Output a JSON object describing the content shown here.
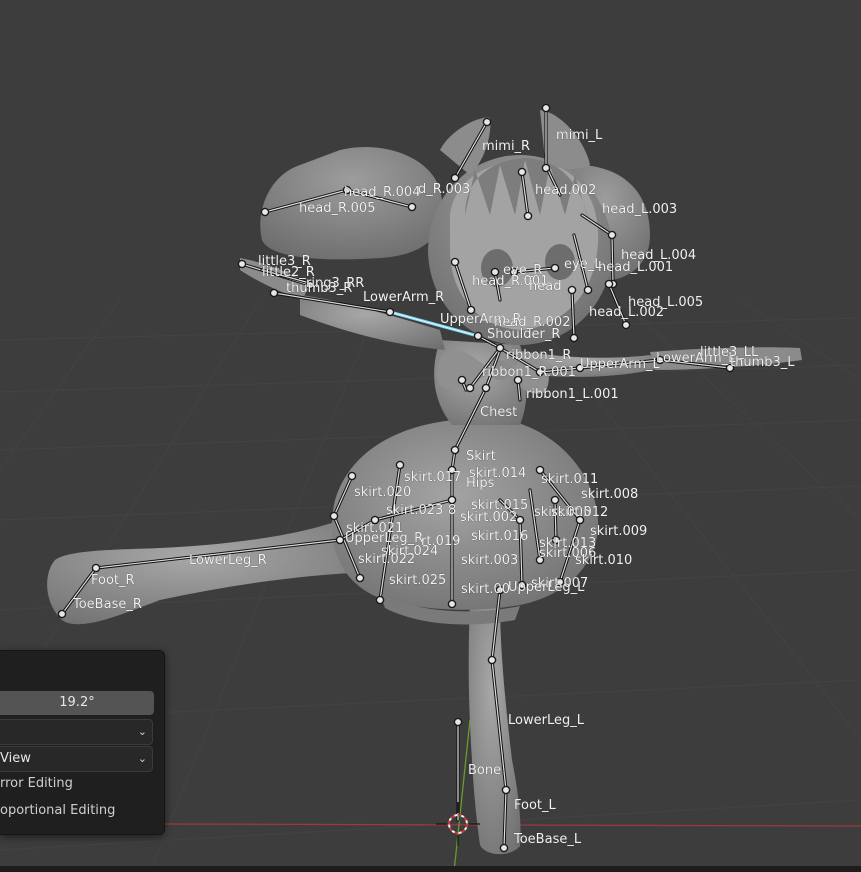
{
  "panel": {
    "angle_value": "19.2°",
    "dropdown1_value": "",
    "dropdown2_value": "View",
    "checkbox1_label": "rror Editing",
    "checkbox2_label": "oportional Editing"
  },
  "bones": {
    "mimi_L": "mimi_L",
    "mimi_R": "mimi_R",
    "head_R_004": "head_R.004",
    "head_R_003": "d_R.003",
    "head_R_005": "head_R.005",
    "head_002": "head.002",
    "head_L_003": "head_L.003",
    "head_L_004": "head_L.004",
    "head_L_001": "head_L.001",
    "head_L_005": "head_L.005",
    "head_L_002": "head_L.002",
    "eye_R": "eye_R",
    "eye_L": "eye_L",
    "head_R_001": "head_R.001",
    "head": "head",
    "head_R_002": "head_R.002",
    "little3_R": "little3_R",
    "little2_R": "little2_R",
    "ring_R": "ring3_RR",
    "thumb3_R": "thumb3_R",
    "lowerarm_R": "LowerArm_R",
    "upperarm_R": "UpperArm_R",
    "shoulder_R": "Shoulder_R",
    "ribbon1_R": "ribbon1_R",
    "ribbon1_R_001": "ribbon1_R.001",
    "ribbon1_L_001": "ribbon1_L.001",
    "upperarm_L": "UpperArm_L",
    "lowerarm_L": "LowerArm_L",
    "little3_LL": "little3_LL",
    "thumb3_L": "thumb3_L",
    "chest": "Chest",
    "skirt": "Skirt",
    "hips": "Hips",
    "skirt_017": "skirt.017",
    "skirt_014": "skirt.014",
    "skirt_011": "skirt.011",
    "skirt_008": "skirt.008",
    "skirt_020": "skirt.020",
    "skirt_023": "skirt.023",
    "skirt_018": "8",
    "skirt_015": "skirt.015",
    "skirt_012": "skirt.012",
    "skirt_005": "skirt.005",
    "skirt_002": "skirt.002",
    "skirt_009": "skirt.009",
    "skirt_021": "skirt.021",
    "upperleg_R": "UpperLeg_R",
    "skirt_019": "rt.019",
    "skirt_016": "skirt.016",
    "skirt_013": "skirt.013",
    "skirt_024": "skirt.024",
    "skirt_006": "skirt.006",
    "skirt_022": "skirt.022",
    "skirt_003": "skirt.003",
    "skirt_010": "skirt.010",
    "skirt_025": "skirt.025",
    "skirt_007": "skirt.007",
    "skirt_004": "skirt.00",
    "upperleg_L": "UpperLeg_L",
    "lowerleg_R": "LowerLeg_R",
    "foot_R": "Foot_R",
    "toebase_R": "ToeBase_R",
    "lowerleg_L": "LowerLeg_L",
    "bone": "Bone",
    "foot_L": "Foot_L",
    "toebase_L": "ToeBase_L"
  },
  "colors": {
    "background": "#3d3d3d",
    "model": "#8f8f8f",
    "x_axis": "#a2373d",
    "y_axis": "#6b9a2b",
    "active_bone": "#7fd6ee"
  }
}
